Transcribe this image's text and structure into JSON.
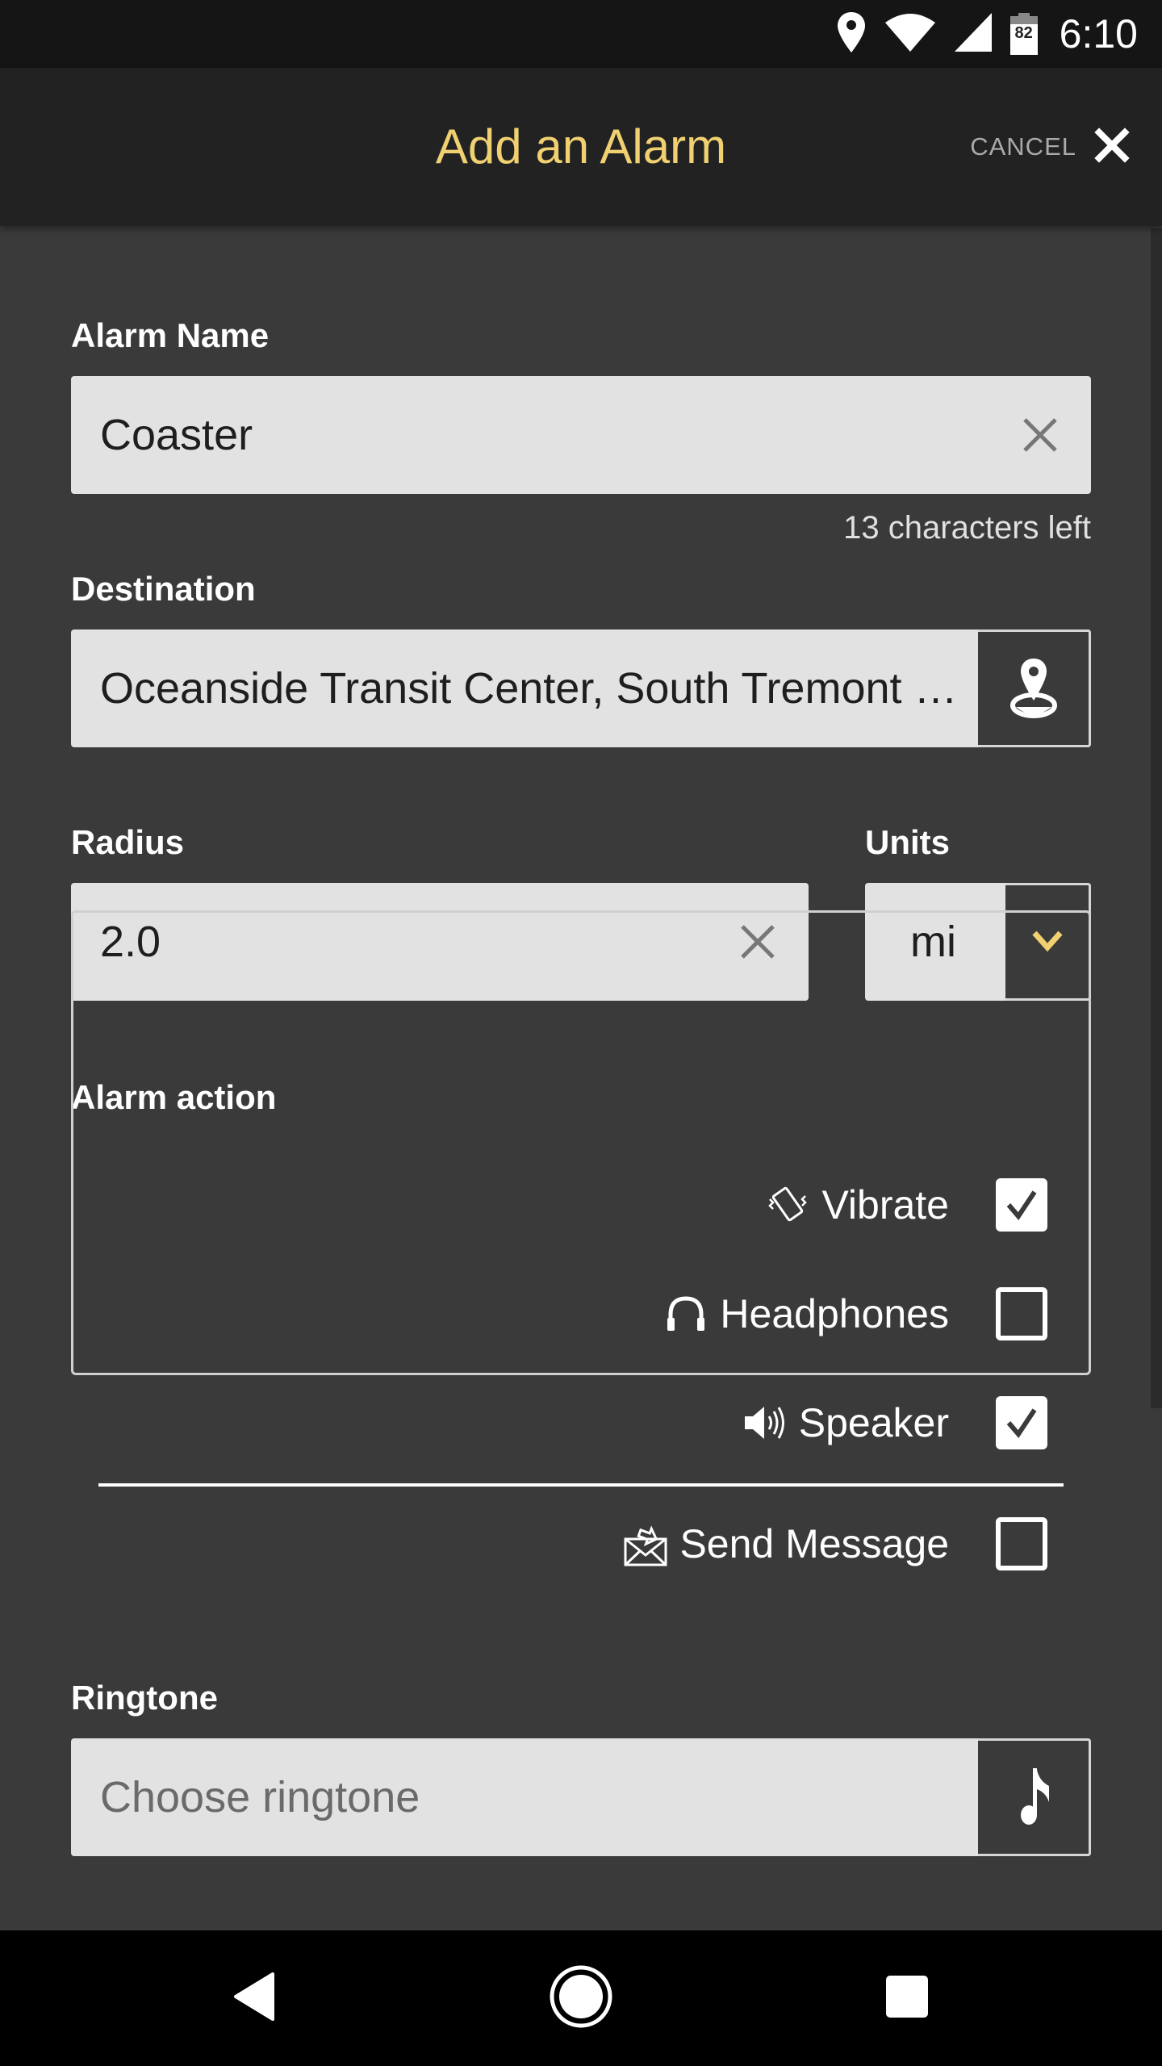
{
  "status_bar": {
    "battery_level": "82",
    "time": "6:10",
    "icons": [
      "location-icon",
      "wifi-icon",
      "cell-signal-icon",
      "battery-icon"
    ]
  },
  "app_bar": {
    "title": "Add an Alarm",
    "cancel_label": "CANCEL",
    "title_color": "#f0d070"
  },
  "form": {
    "alarm_name": {
      "label": "Alarm Name",
      "value": "Coaster",
      "helper": "13 characters left"
    },
    "destination": {
      "label": "Destination",
      "value": "Oceanside Transit Center, South Tremont …",
      "button_icon": "map-pin-icon"
    },
    "radius": {
      "label": "Radius",
      "value": "2.0"
    },
    "units": {
      "label": "Units",
      "selected": "mi",
      "chevron_color": "#f0d070"
    },
    "alarm_action": {
      "label": "Alarm action",
      "options": [
        {
          "label": "Vibrate",
          "icon": "vibrate-icon",
          "checked": true
        },
        {
          "label": "Headphones",
          "icon": "headphones-icon",
          "checked": false
        },
        {
          "label": "Speaker",
          "icon": "speaker-icon",
          "checked": true
        },
        {
          "label": "Send Message",
          "icon": "send-message-icon",
          "checked": false
        }
      ]
    },
    "ringtone": {
      "label": "Ringtone",
      "placeholder": "Choose ringtone",
      "button_icon": "music-note-icon"
    }
  },
  "nav_bar": {
    "buttons": [
      "back",
      "home",
      "recents"
    ]
  }
}
